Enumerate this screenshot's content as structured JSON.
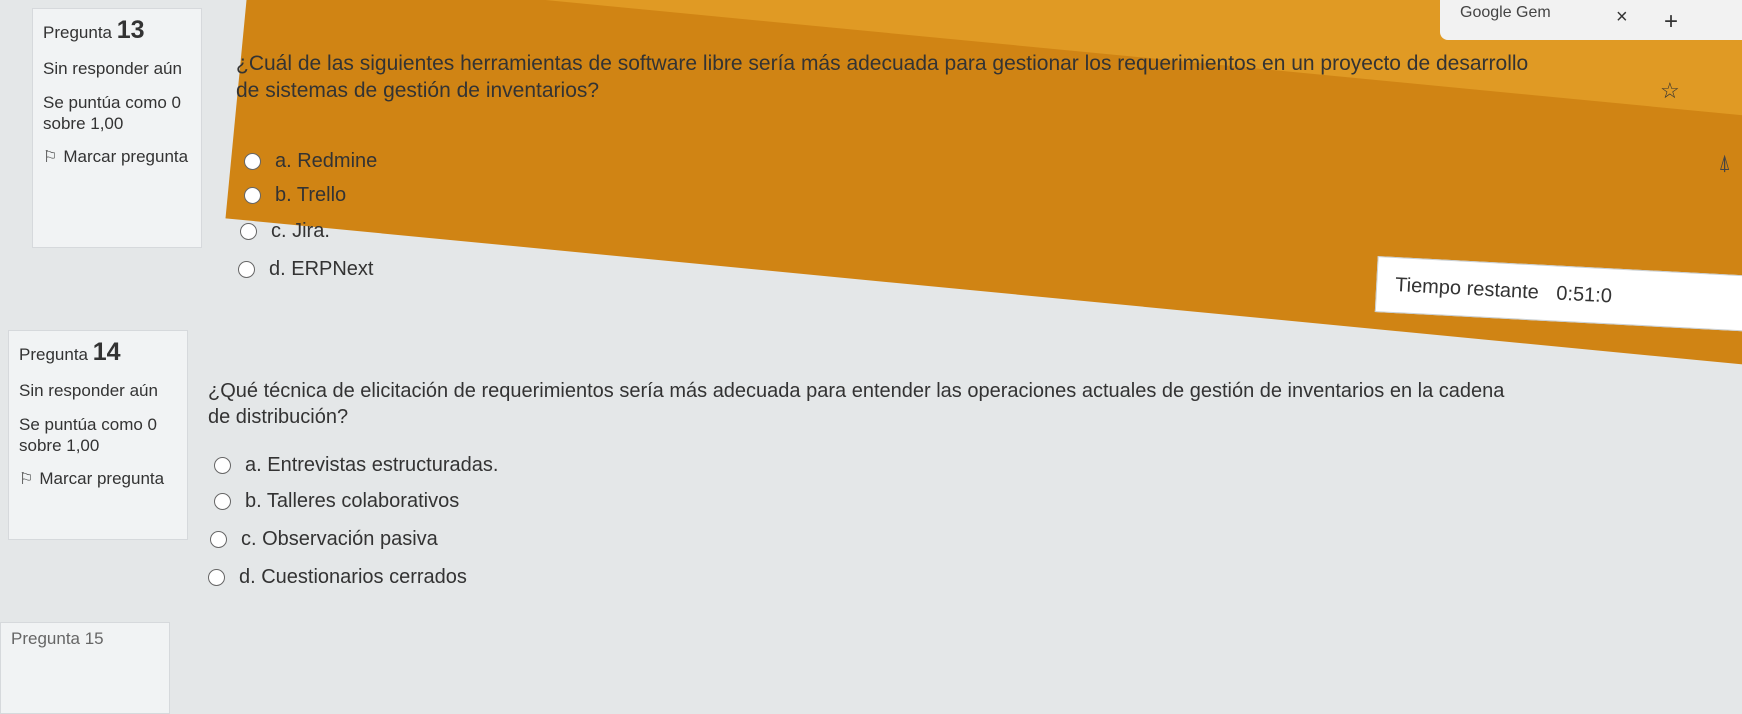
{
  "browser": {
    "tab_label": "Google Gem",
    "tab_close": "×",
    "new_tab": "+",
    "star_icon": "☆"
  },
  "questions": [
    {
      "info": {
        "label": "Pregunta",
        "number": "13",
        "status": "Sin responder aún",
        "score": "Se puntúa como 0 sobre 1,00",
        "flag_label": "Marcar pregunta"
      },
      "text": "¿Cuál de las siguientes herramientas de software libre sería más adecuada para gestionar los requerimientos en un proyecto de desarrollo de sistemas de gestión de inventarios?",
      "options": [
        "a. Redmine",
        "b. Trello",
        "c. Jira.",
        "d. ERPNext"
      ]
    },
    {
      "info": {
        "label": "Pregunta",
        "number": "14",
        "status": "Sin responder aún",
        "score": "Se puntúa como 0 sobre 1,00",
        "flag_label": "Marcar pregunta"
      },
      "text": "¿Qué técnica de elicitación de requerimientos sería más adecuada para entender las operaciones actuales de gestión de inventarios en la cadena de distribución?",
      "options": [
        "a. Entrevistas estructuradas.",
        "b. Talleres colaborativos",
        "c. Observación pasiva",
        "d. Cuestionarios cerrados"
      ]
    }
  ],
  "next_question_label": "Pregunta 15",
  "timer": {
    "label": "Tiempo restante",
    "value": "0:51:0"
  }
}
